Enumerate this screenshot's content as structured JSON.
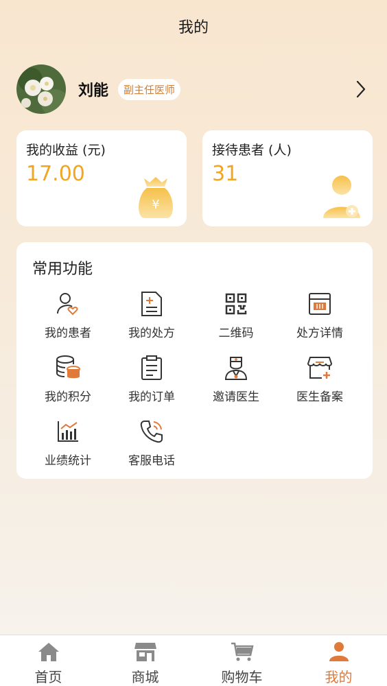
{
  "header": {
    "title": "我的"
  },
  "profile": {
    "name": "刘能",
    "title": "副主任医师"
  },
  "stats": {
    "earnings": {
      "label": "我的收益 (元)",
      "value": "17.00"
    },
    "patients": {
      "label": "接待患者 (人)",
      "value": "31"
    }
  },
  "functions": {
    "title": "常用功能",
    "items": [
      {
        "label": "我的患者",
        "icon": "patient-heart-icon"
      },
      {
        "label": "我的处方",
        "icon": "prescription-icon"
      },
      {
        "label": "二维码",
        "icon": "qr-code-icon"
      },
      {
        "label": "处方详情",
        "icon": "prescription-detail-icon"
      },
      {
        "label": "我的积分",
        "icon": "points-coins-icon"
      },
      {
        "label": "我的订单",
        "icon": "order-clipboard-icon"
      },
      {
        "label": "邀请医生",
        "icon": "doctor-icon"
      },
      {
        "label": "医生备案",
        "icon": "store-register-icon"
      },
      {
        "label": "业绩统计",
        "icon": "bar-chart-icon"
      },
      {
        "label": "客服电话",
        "icon": "phone-icon"
      }
    ]
  },
  "tabbar": {
    "items": [
      {
        "label": "首页",
        "icon": "home-icon"
      },
      {
        "label": "商城",
        "icon": "shop-icon"
      },
      {
        "label": "购物车",
        "icon": "cart-icon"
      },
      {
        "label": "我的",
        "icon": "user-icon",
        "active": true
      }
    ]
  },
  "colors": {
    "accent": "#f0a622",
    "active_tab": "#e07a3a",
    "badge_text": "#d0803a"
  }
}
